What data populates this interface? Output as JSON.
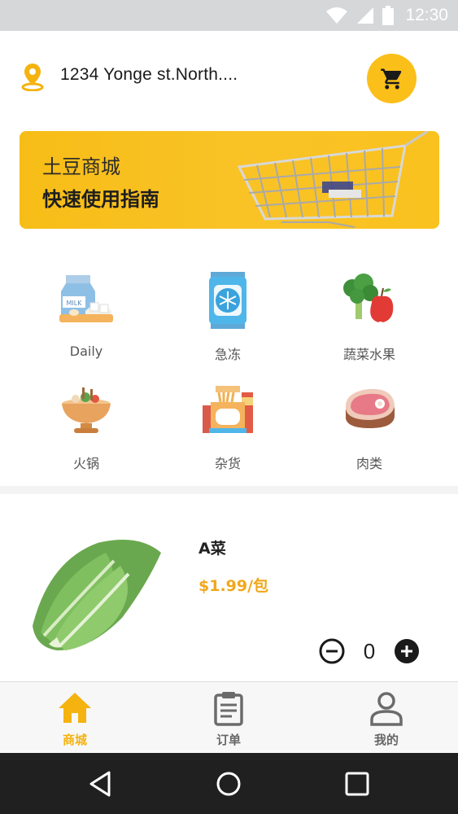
{
  "status_bar": {
    "time": "12:30",
    "icons": [
      "wifi-icon",
      "signal-icon",
      "battery-icon"
    ]
  },
  "header": {
    "address": "1234 Yonge st.North....",
    "pin_icon": "location-pin-icon",
    "cart_icon": "shopping-cart-icon"
  },
  "banner": {
    "line1": "土豆商城",
    "line2": "快速使用指南"
  },
  "categories": [
    {
      "label": "Daily",
      "icon": "milk-icon"
    },
    {
      "label": "急冻",
      "icon": "frozen-icon"
    },
    {
      "label": "蔬菜水果",
      "icon": "vegetable-fruit-icon"
    },
    {
      "label": "火锅",
      "icon": "hotpot-icon"
    },
    {
      "label": "杂货",
      "icon": "grocery-icon"
    },
    {
      "label": "肉类",
      "icon": "meat-icon"
    }
  ],
  "product": {
    "name": "A菜",
    "price": "$1.99/包",
    "quantity": "0"
  },
  "bottom_nav": [
    {
      "label": "商城",
      "icon": "home-icon",
      "active": true
    },
    {
      "label": "订单",
      "icon": "clipboard-icon",
      "active": false
    },
    {
      "label": "我的",
      "icon": "person-icon",
      "active": false
    }
  ],
  "colors": {
    "accent": "#fbbf1a",
    "price": "#f0a81c",
    "nav_active": "#f5b30f"
  }
}
